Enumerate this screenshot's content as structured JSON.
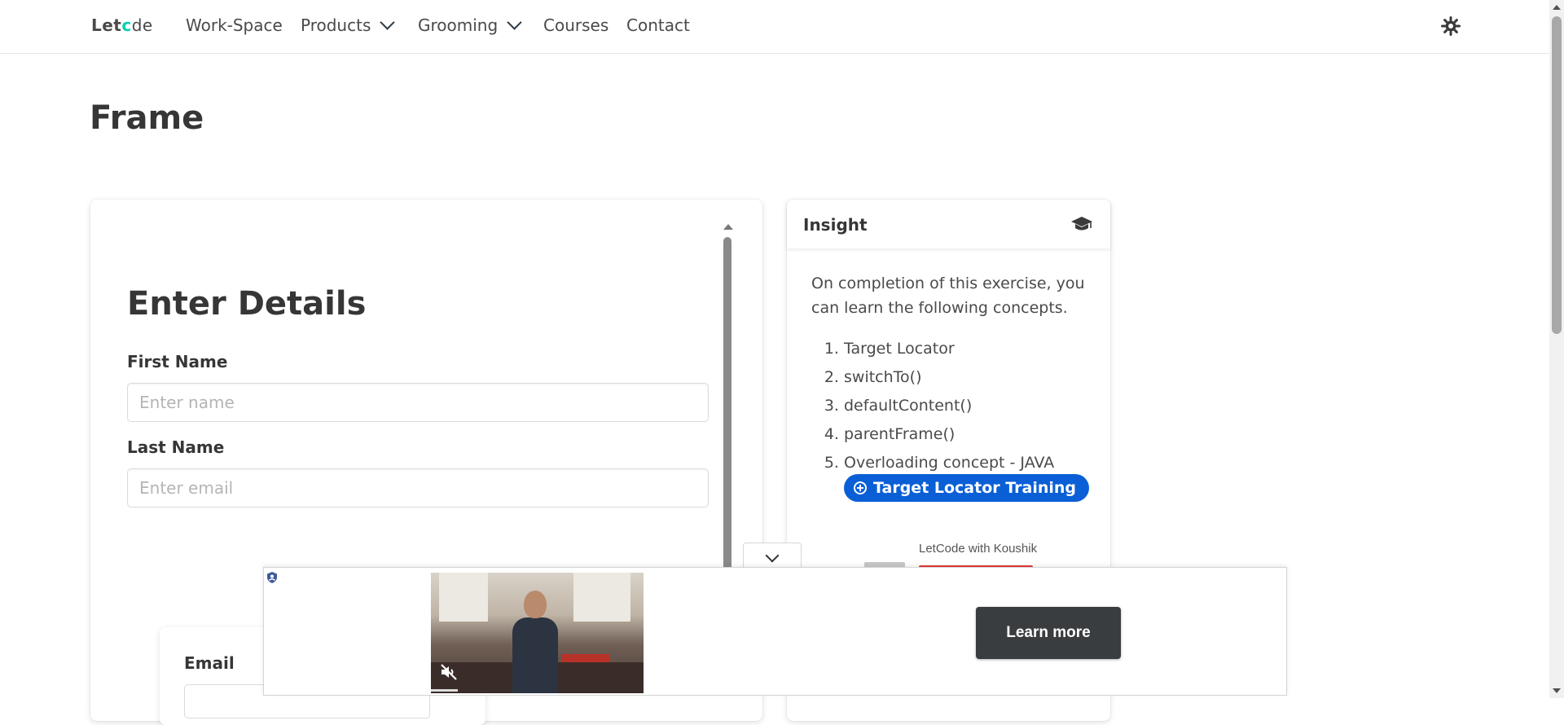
{
  "nav": {
    "brand": {
      "part1": "Let",
      "part2": "c",
      "part3": "de",
      "logo_icon": "gear-o-icon"
    },
    "items": [
      "Work-Space",
      "Products",
      "Grooming",
      "Courses",
      "Contact"
    ],
    "theme_icon": "sun-gear-icon"
  },
  "page": {
    "title": "Frame"
  },
  "form": {
    "heading": "Enter Details",
    "first_name": {
      "label": "First Name",
      "placeholder": "Enter name",
      "value": ""
    },
    "last_name": {
      "label": "Last Name",
      "placeholder": "Enter email",
      "value": ""
    },
    "email": {
      "label": "Email"
    }
  },
  "insight": {
    "title": "Insight",
    "icon": "graduation-cap-icon",
    "description": "On completion of this exercise, you can learn the following concepts.",
    "concepts": [
      "Target Locator",
      "switchTo()",
      "defaultContent()",
      "parentFrame()",
      "Overloading concept - JAVA"
    ],
    "training_button": "Target Locator Training",
    "video_channel": "LetCode with Koushik"
  },
  "ad": {
    "cta": "Learn more",
    "mute_icon": "muted-speaker-icon",
    "badge_icon": "ad-choices-icon"
  },
  "colors": {
    "accent": "#0a5fd6",
    "brand_accent": "#00d1b2",
    "cta_bg": "#3a3d40"
  }
}
